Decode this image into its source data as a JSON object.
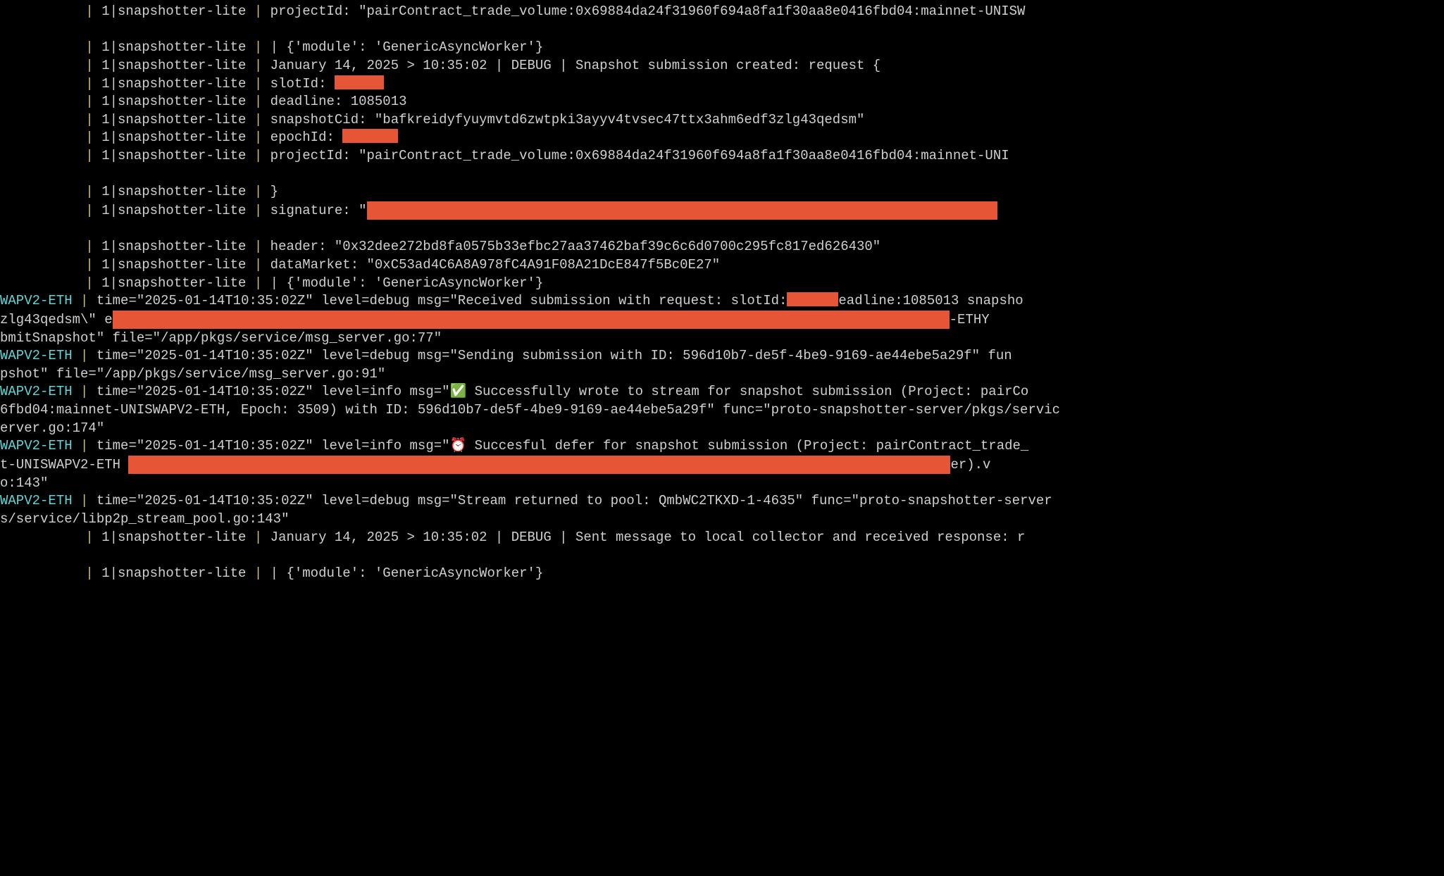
{
  "prefix": {
    "pipe": " | ",
    "proc": "1|snapshotter-lite ",
    "tag": "WAPV2-ETH"
  },
  "lines": [
    {
      "proc": true,
      "text": "projectId: \"pairContract_trade_volume:0x69884da24f31960f694a8fa1f30aa8e0416fbd04:mainnet-UNISW"
    },
    {
      "blank": true
    },
    {
      "proc": true,
      "text": "| {'module': 'GenericAsyncWorker'}"
    },
    {
      "proc": true,
      "text": "January 14, 2025 > 10:35:02 | DEBUG | Snapshot submission created: request {"
    },
    {
      "proc": true,
      "text": "  slotId: ",
      "redact": "r1"
    },
    {
      "proc": true,
      "text": "  deadline: 1085013"
    },
    {
      "proc": true,
      "text": "  snapshotCid: \"bafkreidyfyuymvtd6zwtpki3ayyv4tvsec47ttx3ahm6edf3zlg43qedsm\""
    },
    {
      "proc": true,
      "text": "  epochId: ",
      "redact": "r2"
    },
    {
      "proc": true,
      "text": "  projectId: \"pairContract_trade_volume:0x69884da24f31960f694a8fa1f30aa8e0416fbd04:mainnet-UNI"
    },
    {
      "blank": true
    },
    {
      "proc": true,
      "text": "}"
    },
    {
      "proc": true,
      "text": "signature: \"",
      "redact": "r3",
      "redactTall": true
    },
    {
      "blank": true
    },
    {
      "proc": true,
      "text": "header: \"0x32dee272bd8fa0575b33efbc27aa37462baf39c6c6d0700c295fc817ed626430\""
    },
    {
      "proc": true,
      "text": "dataMarket: \"0xC53ad4C6A8A978fC4A91F08A21DcE847f5Bc0E27\""
    },
    {
      "proc": true,
      "text": "| {'module': 'GenericAsyncWorker'}"
    },
    {
      "tag": true,
      "pre": "time=\"2025-01-14T10:35:02Z\" level=debug msg=\"Received submission with request:  slotId:",
      "redact": "r4",
      "post": "eadline:1085013 snapsho"
    },
    {
      "raw": true,
      "pre": "zlg43qedsm\\\" e",
      "redact": "r5",
      "post": "-ETHY",
      "redactTall": true
    },
    {
      "raw": true,
      "pre": "bmitSnapshot\" file=\"/app/pkgs/service/msg_server.go:77\""
    },
    {
      "tag": true,
      "pre": "time=\"2025-01-14T10:35:02Z\" level=debug msg=\"Sending submission with ID:  596d10b7-de5f-4be9-9169-ae44ebe5a29f\"  fun"
    },
    {
      "raw": true,
      "pre": "pshot\" file=\"/app/pkgs/service/msg_server.go:91\""
    },
    {
      "tag": true,
      "pre": "time=\"2025-01-14T10:35:02Z\" level=info msg=\"✅ Successfully wrote to stream for snapshot submission (Project: pairCo"
    },
    {
      "raw": true,
      "pre": "6fbd04:mainnet-UNISWAPV2-ETH, Epoch: 3509) with ID: 596d10b7-de5f-4be9-9169-ae44ebe5a29f\" func=\"proto-snapshotter-server/pkgs/servic"
    },
    {
      "raw": true,
      "pre": "erver.go:174\""
    },
    {
      "tag": true,
      "pre": "time=\"2025-01-14T10:35:02Z\" level=info msg=\"⏰ Succesful defer for snapshot submission (Project: pairContract_trade_"
    },
    {
      "raw": true,
      "pre": "t-UNISWAPV2-ETH ",
      "redact": "r6",
      "redactTall": true,
      "post": "er).v"
    },
    {
      "raw": true,
      "pre": "o:143\""
    },
    {
      "tag": true,
      "pre": "time=\"2025-01-14T10:35:02Z\" level=debug msg=\"Stream returned to pool: QmbWC2TKXD-1-4635\" func=\"proto-snapshotter-server"
    },
    {
      "raw": true,
      "pre": "s/service/libp2p_stream_pool.go:143\""
    },
    {
      "proc": true,
      "text": "January 14, 2025 > 10:35:02 | DEBUG | Sent message to local collector and received response: r"
    },
    {
      "blank": true
    },
    {
      "proc": true,
      "text": "| {'module': 'GenericAsyncWorker'}"
    }
  ]
}
